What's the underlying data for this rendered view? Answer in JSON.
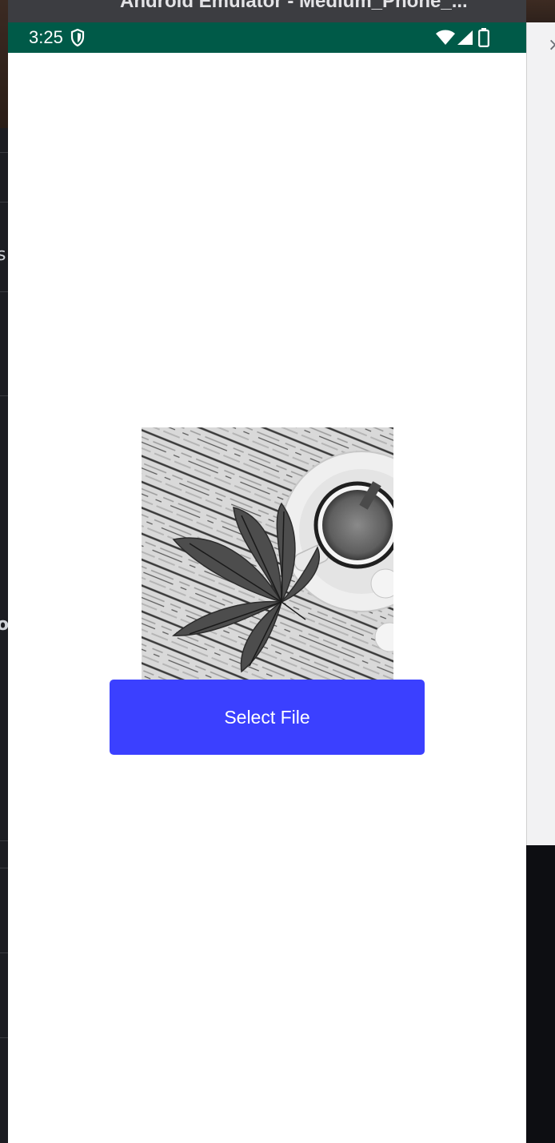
{
  "emulator": {
    "title": "Android Emulator - Medium_Phone_..."
  },
  "status_bar": {
    "time": "3:25",
    "icons": [
      "shield-icon",
      "wifi-icon",
      "signal-icon",
      "battery-icon"
    ],
    "background_color": "#005a48"
  },
  "image": {
    "description_icon": "photo-leaf-coffee"
  },
  "main": {
    "select_button_label": "Select File",
    "select_button_color": "#3b40ff"
  },
  "side_panel": {
    "close_glyph": "×"
  },
  "left_strip": {
    "glyph_1": "s",
    "glyph_2": "o"
  }
}
